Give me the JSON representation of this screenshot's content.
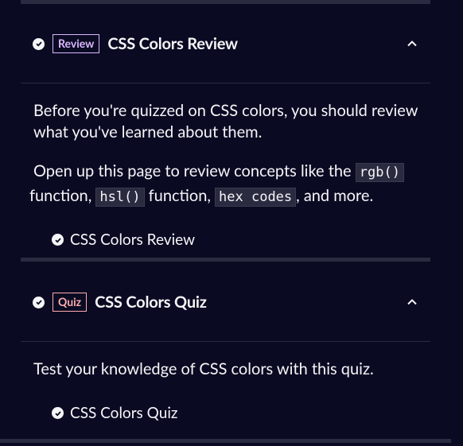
{
  "review_block": {
    "badge": "Review",
    "title": "CSS Colors Review",
    "paragraph1": "Before you're quizzed on CSS colors, you should review what you've learned about them.",
    "p2_part1": "Open up this page to review concepts like the ",
    "code1": "rgb()",
    "p2_part2": " function, ",
    "code2": "hsl()",
    "p2_part3": " function, ",
    "code3": "hex codes",
    "p2_part4": ", and more.",
    "link": "CSS Colors Review"
  },
  "quiz_block": {
    "badge": "Quiz",
    "title": "CSS Colors Quiz",
    "paragraph1": "Test your knowledge of CSS colors with this quiz.",
    "link": "CSS Colors Quiz"
  },
  "colors": {
    "background": "#0a0a23",
    "review_accent": "#dbb8ff",
    "quiz_accent": "#ffadad"
  }
}
